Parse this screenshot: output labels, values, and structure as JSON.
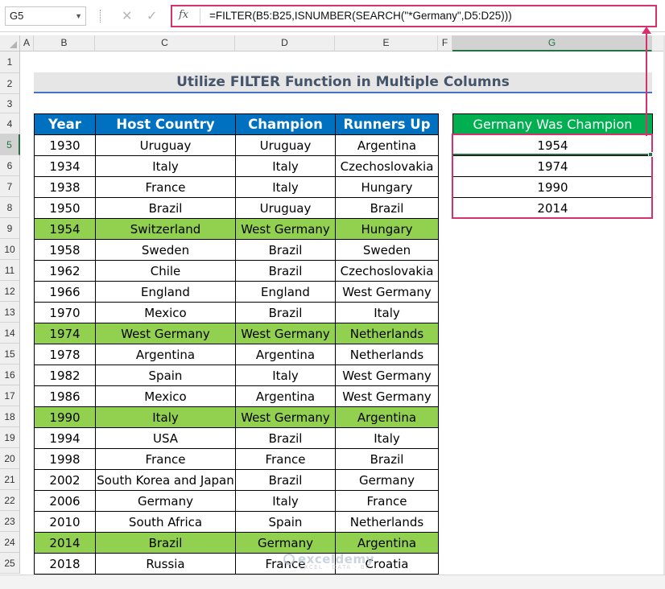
{
  "formula_bar": {
    "name_box": "G5",
    "fx_label": "fx",
    "formula": "=FILTER(B5:B25,ISNUMBER(SEARCH(\"*Germany\",D5:D25)))"
  },
  "columns": [
    "A",
    "B",
    "C",
    "D",
    "E",
    "F",
    "G"
  ],
  "rows": [
    "1",
    "2",
    "3",
    "4",
    "5",
    "6",
    "7",
    "8",
    "9",
    "10",
    "11",
    "12",
    "13",
    "14",
    "15",
    "16",
    "17",
    "18",
    "19",
    "20",
    "21",
    "22",
    "23",
    "24",
    "25"
  ],
  "selected_column": "G",
  "selected_row": "5",
  "sheet": {
    "title": "Utilize FILTER Function in Multiple Columns",
    "headers": [
      "Year",
      "Host Country",
      "Champion",
      "Runners Up"
    ],
    "data": [
      [
        "1930",
        "Uruguay",
        "Uruguay",
        "Argentina"
      ],
      [
        "1934",
        "Italy",
        "Italy",
        "Czechoslovakia"
      ],
      [
        "1938",
        "France",
        "Italy",
        "Hungary"
      ],
      [
        "1950",
        "Brazil",
        "Uruguay",
        "Brazil"
      ],
      [
        "1954",
        "Switzerland",
        "West Germany",
        "Hungary"
      ],
      [
        "1958",
        "Sweden",
        "Brazil",
        "Sweden"
      ],
      [
        "1962",
        "Chile",
        "Brazil",
        "Czechoslovakia"
      ],
      [
        "1966",
        "England",
        "England",
        "West Germany"
      ],
      [
        "1970",
        "Mexico",
        "Brazil",
        "Italy"
      ],
      [
        "1974",
        "West Germany",
        "West Germany",
        "Netherlands"
      ],
      [
        "1978",
        "Argentina",
        "Argentina",
        "Netherlands"
      ],
      [
        "1982",
        "Spain",
        "Italy",
        "West Germany"
      ],
      [
        "1986",
        "Mexico",
        "Argentina",
        "West Germany"
      ],
      [
        "1990",
        "Italy",
        "West Germany",
        "Argentina"
      ],
      [
        "1994",
        "USA",
        "Brazil",
        "Italy"
      ],
      [
        "1998",
        "France",
        "France",
        "Brazil"
      ],
      [
        "2002",
        "South Korea and Japan",
        "Brazil",
        "Germany"
      ],
      [
        "2006",
        "Germany",
        "Italy",
        "France"
      ],
      [
        "2010",
        "South Africa",
        "Spain",
        "Netherlands"
      ],
      [
        "2014",
        "Brazil",
        "Germany",
        "Argentina"
      ],
      [
        "2018",
        "Russia",
        "France",
        "Croatia"
      ]
    ],
    "highlighted_rows": [
      4,
      9,
      13,
      19
    ],
    "result_header": "Germany Was Champion",
    "results": [
      "1954",
      "1974",
      "1990",
      "2014"
    ]
  },
  "watermark": {
    "brand": "exceldemy",
    "tagline": "EXCEL · DATA · BI"
  },
  "colors": {
    "header_blue": "#0070c0",
    "result_header_green": "#00b050",
    "highlight_green": "#92d050",
    "annotation_pink": "#d6306d",
    "title_text": "#44546a"
  }
}
